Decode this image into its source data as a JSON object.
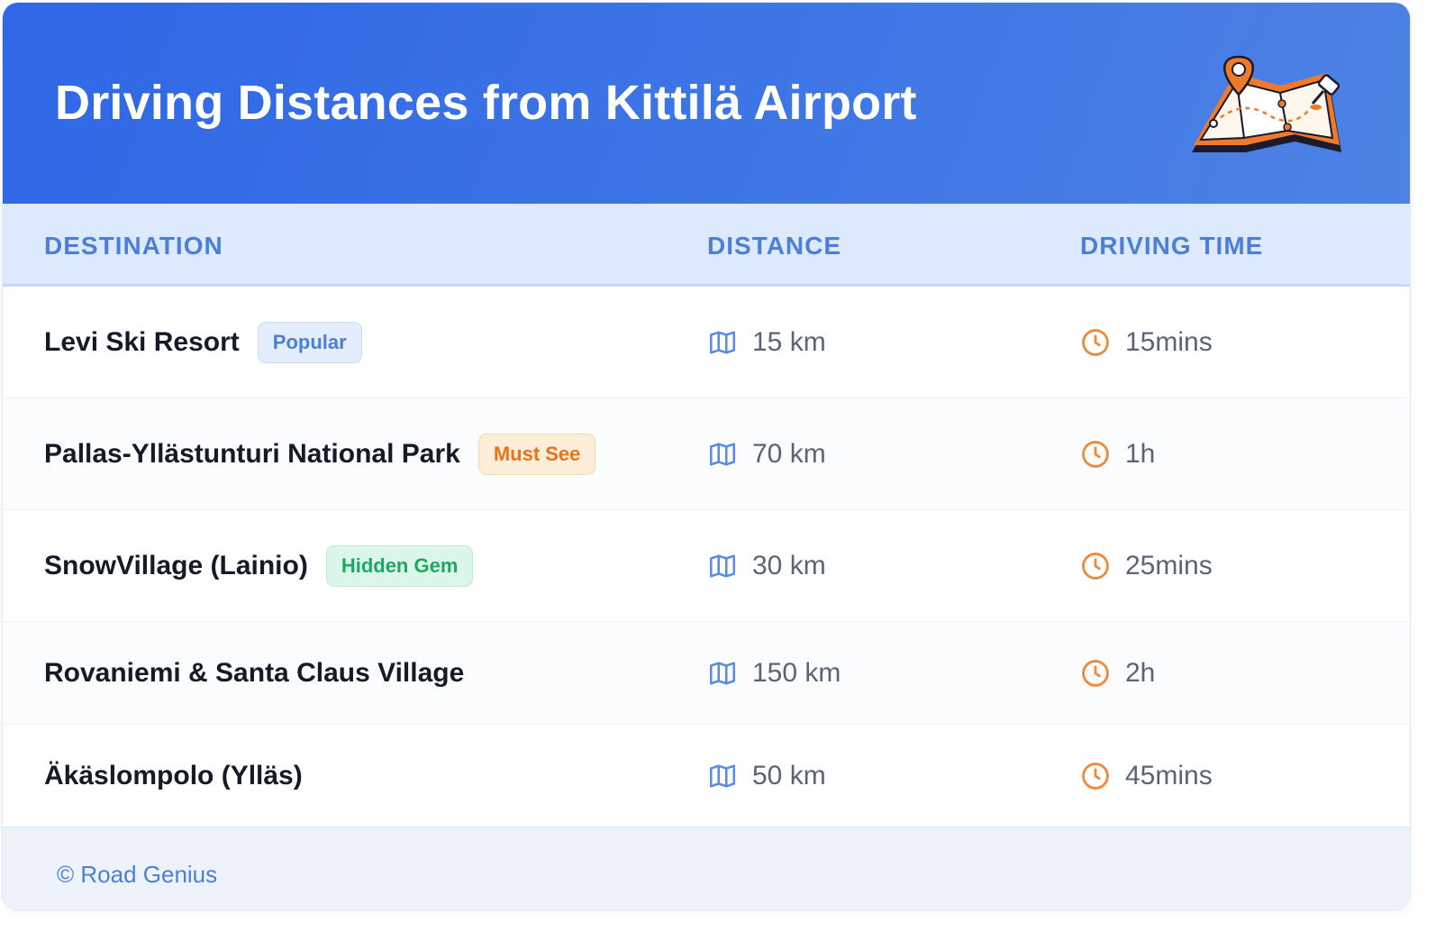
{
  "header": {
    "title": "Driving Distances from Kittilä Airport",
    "illustration": "map-with-pins-icon"
  },
  "table": {
    "columns": [
      "DESTINATION",
      "DISTANCE",
      "DRIVING TIME"
    ],
    "rows": [
      {
        "destination": "Levi Ski Resort",
        "badge": "Popular",
        "badge_color": "#4b7fd8",
        "distance": "15 km",
        "time": "15mins"
      },
      {
        "destination": "Pallas-Yllästunturi National Park",
        "badge": "Must See",
        "badge_color": "#ea7317",
        "distance": "70 km",
        "time": "1h"
      },
      {
        "destination": "SnowVillage (Lainio)",
        "badge": "Hidden Gem",
        "badge_color": "#1fa864",
        "distance": "30 km",
        "time": "25mins"
      },
      {
        "destination": "Rovaniemi & Santa Claus Village",
        "badge": null,
        "distance": "150 km",
        "time": "2h"
      },
      {
        "destination": "Äkäslompolo (Ylläs)",
        "badge": null,
        "distance": "50 km",
        "time": "45mins"
      }
    ],
    "distance_icon": "map-icon",
    "time_icon": "clock-icon"
  },
  "footer": {
    "text": "© Road Genius"
  },
  "colors": {
    "header_gradient_start": "#2f67e6",
    "header_gradient_end": "#4d82e4",
    "column_header_text": "#4d7fd9",
    "map_icon": "#5b8ce0",
    "clock_icon": "#f0893a"
  }
}
